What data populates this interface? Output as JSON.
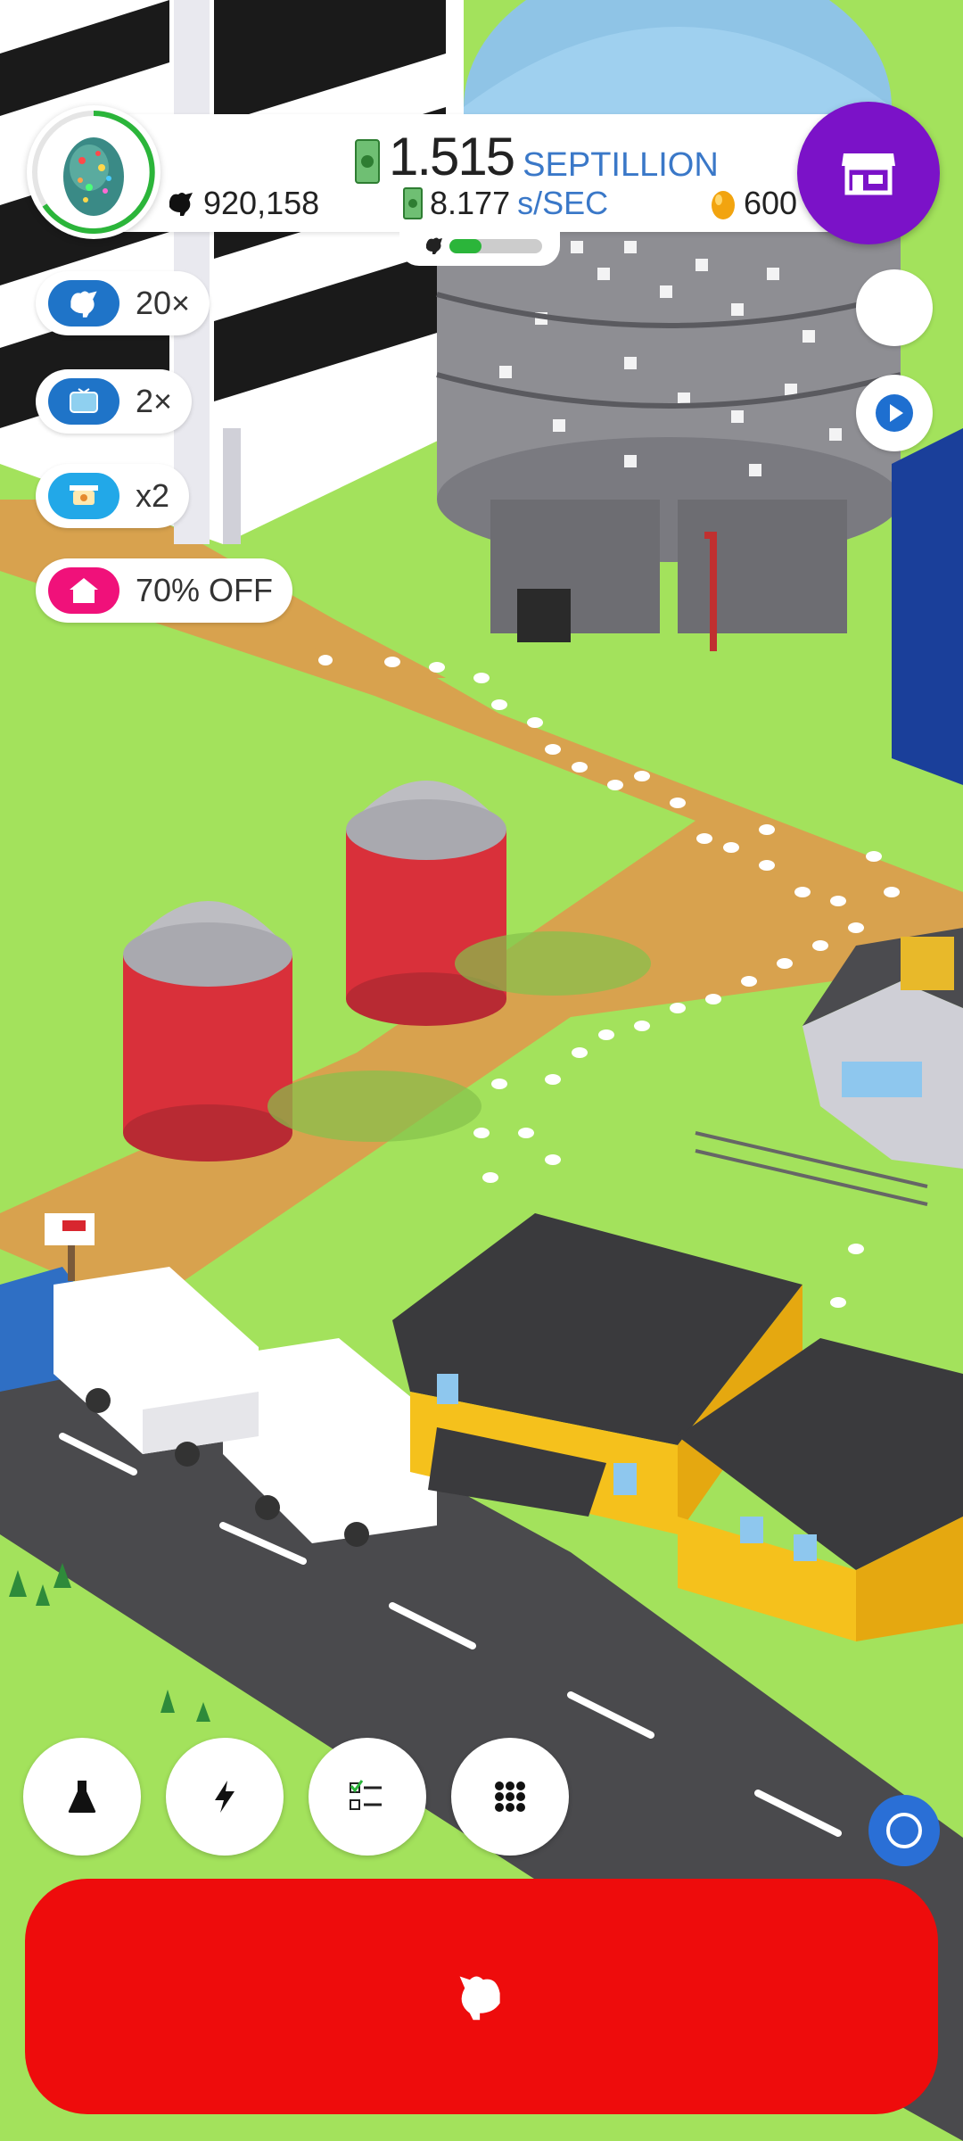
{
  "header": {
    "money_value": "1.515",
    "money_unit": "SEPTILLION",
    "chicken_count": "920,158",
    "rate_value": "8.177",
    "rate_unit": "s/SEC",
    "golden_eggs": "600",
    "habitat_progress": 0.35
  },
  "boosts": [
    {
      "label": "20×",
      "icon": "chicken-boost-icon",
      "color": "#1f74c8"
    },
    {
      "label": "2×",
      "icon": "tv-ad-boost-icon",
      "color": "#1f74c8"
    },
    {
      "label": "x2",
      "icon": "drone-boost-icon",
      "color": "#22a8e8"
    },
    {
      "label": "70% OFF",
      "icon": "house-sale-icon",
      "color": "#f0117a"
    }
  ],
  "menu": [
    {
      "name": "research-button",
      "icon": "flask-icon"
    },
    {
      "name": "boosts-button",
      "icon": "lightning-icon"
    },
    {
      "name": "missions-button",
      "icon": "checklist-icon"
    },
    {
      "name": "more-menu-button",
      "icon": "grid-icon"
    }
  ],
  "colors": {
    "grass": "#a3e25c",
    "path": "#d7a14f",
    "road": "#4a4a4d",
    "shop_purple": "#7b12c8",
    "hatch_red": "#ee0c0c",
    "accent_blue": "#3a78c8"
  }
}
